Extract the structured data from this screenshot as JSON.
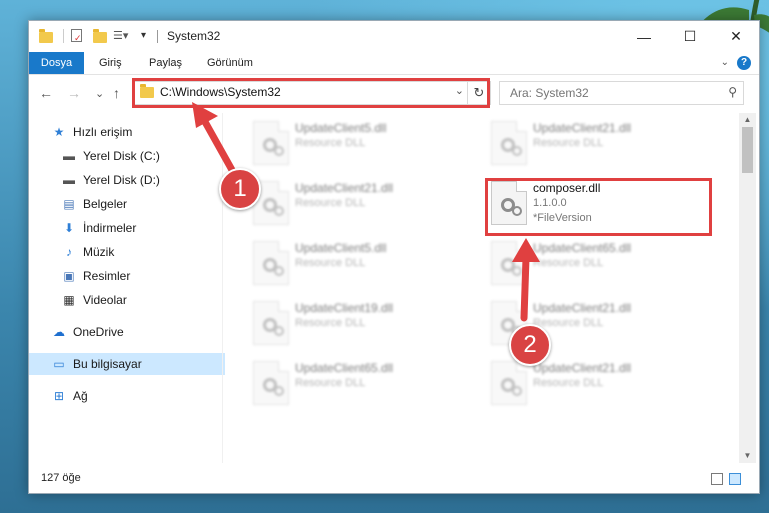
{
  "window": {
    "title": "System32",
    "min_glyph": "—",
    "max_glyph": "☐",
    "close_glyph": "✕"
  },
  "ribbon": {
    "tabs": [
      "Dosya",
      "Giriş",
      "Paylaş",
      "Görünüm"
    ],
    "help_glyph": "?",
    "expand_glyph": "⌄"
  },
  "nav": {
    "back_glyph": "←",
    "forward_glyph": "→",
    "recent_glyph": "⌄",
    "up_glyph": "↑",
    "address": "C:\\Windows\\System32",
    "address_drop_glyph": "⌄",
    "refresh_glyph": "↻",
    "search_placeholder": "Ara: System32",
    "search_glyph": "⚲"
  },
  "sidebar": {
    "items": [
      {
        "label": "Hızlı erişim",
        "icon": "star-icon",
        "glyph": "★",
        "color": "#2f7fd6",
        "pinned": false
      },
      {
        "label": "Yerel Disk (C:)",
        "icon": "drive-icon",
        "glyph": "▬",
        "color": "#555555",
        "pinned": true
      },
      {
        "label": "Yerel Disk (D:)",
        "icon": "drive-icon",
        "glyph": "▬",
        "color": "#555555",
        "pinned": true
      },
      {
        "label": "Belgeler",
        "icon": "documents-icon",
        "glyph": "▤",
        "color": "#4a78b8",
        "pinned": true
      },
      {
        "label": "İndirmeler",
        "icon": "download-icon",
        "glyph": "⬇",
        "color": "#2f7fd6",
        "pinned": true
      },
      {
        "label": "Müzik",
        "icon": "music-icon",
        "glyph": "♪",
        "color": "#2f7fd6",
        "pinned": true
      },
      {
        "label": "Resimler",
        "icon": "pictures-icon",
        "glyph": "▣",
        "color": "#4a78b8",
        "pinned": true
      },
      {
        "label": "Videolar",
        "icon": "videos-icon",
        "glyph": "▦",
        "color": "#333333",
        "pinned": true
      },
      {
        "label": "OneDrive",
        "icon": "cloud-icon",
        "glyph": "☁",
        "color": "#1e6fcf",
        "pinned": false
      },
      {
        "label": "Bu bilgisayar",
        "icon": "computer-icon",
        "glyph": "▭",
        "color": "#2f7fd6",
        "pinned": false,
        "selected": true
      },
      {
        "label": "Ağ",
        "icon": "network-icon",
        "glyph": "⊞",
        "color": "#2f7fd6",
        "pinned": false
      }
    ],
    "pin_glyph": "📌"
  },
  "files": [
    {
      "name": "UpdateClient5.dll",
      "type": "Resource DLL",
      "blurred": true
    },
    {
      "name": "UpdateClient21.dll",
      "type": "Resource DLL",
      "blurred": true
    },
    {
      "name": "UpdateClient21.dll",
      "type": "Resource DLL",
      "blurred": true
    },
    {
      "name": "composer.dll",
      "type": "1.1.0.0",
      "extra": "*FileVersion",
      "blurred": false
    },
    {
      "name": "UpdateClient5.dll",
      "type": "Resource DLL",
      "blurred": true
    },
    {
      "name": "UpdateClient65.dll",
      "type": "Resource DLL",
      "blurred": true
    },
    {
      "name": "UpdateClient19.dll",
      "type": "Resource DLL",
      "blurred": true
    },
    {
      "name": "UpdateClient21.dll",
      "type": "Resource DLL",
      "blurred": true
    },
    {
      "name": "UpdateClient65.dll",
      "type": "Resource DLL",
      "blurred": true
    },
    {
      "name": "UpdateClient21.dll",
      "type": "Resource DLL",
      "blurred": true
    }
  ],
  "status": {
    "count": "127 öğe"
  },
  "annotations": {
    "badge1": "1",
    "badge2": "2",
    "color": "#e04040"
  }
}
